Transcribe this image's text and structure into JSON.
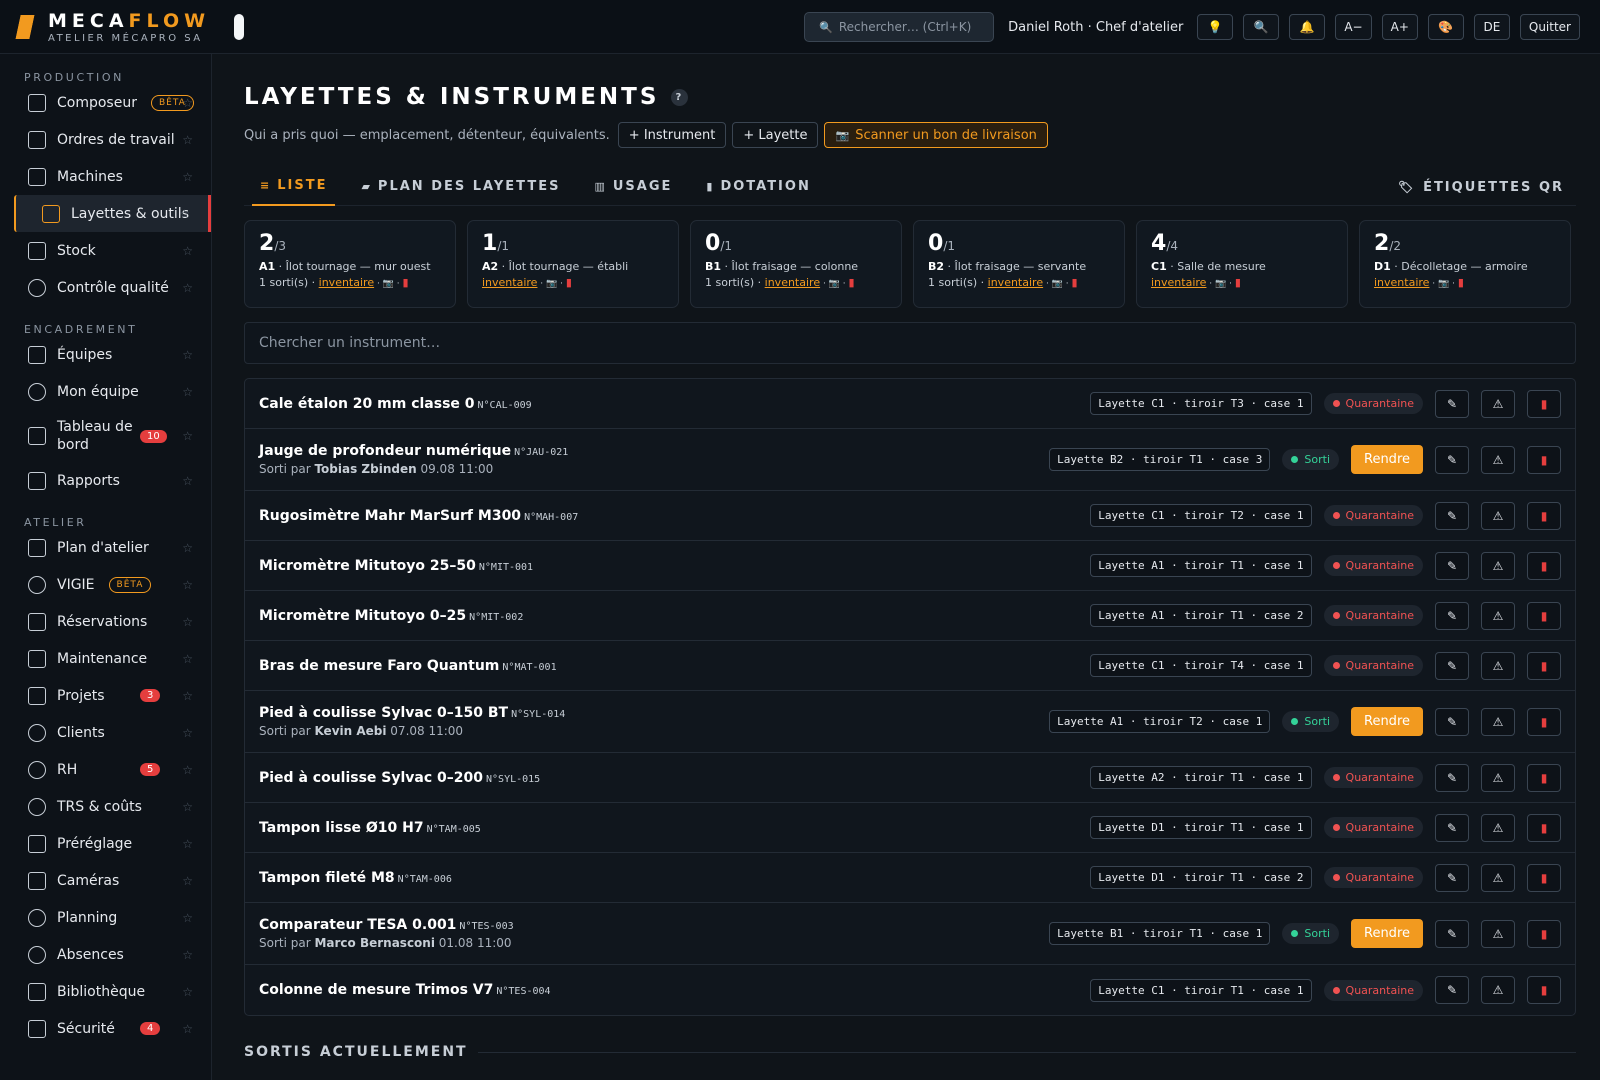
{
  "app": {
    "brand_a": "MECA",
    "brand_b": "FLOW",
    "subtitle": "ATELIER MÉCAPRO SA"
  },
  "topbar": {
    "search_placeholder": "Rechercher…  (Ctrl+K)",
    "user": "Daniel Roth · Chef d'atelier",
    "btn_font_minus": "A−",
    "btn_font_plus": "A+",
    "btn_lang": "DE",
    "btn_quit": "Quitter",
    "icons": [
      "lightbulb-icon",
      "search-icon",
      "bell-icon",
      "palette-icon"
    ]
  },
  "sidebar": {
    "sections": [
      {
        "title": "PRODUCTION",
        "items": [
          {
            "label": "Composeur",
            "beta": "BÊTA",
            "icon": "composer-icon"
          },
          {
            "label": "Ordres de travail",
            "icon": "clipboard-icon"
          },
          {
            "label": "Machines",
            "icon": "grid-icon"
          },
          {
            "label": "Layettes & outils",
            "icon": "box-icon",
            "active": true
          },
          {
            "label": "Stock",
            "icon": "cube-icon"
          },
          {
            "label": "Contrôle qualité",
            "icon": "search-icon"
          }
        ]
      },
      {
        "title": "ENCADREMENT",
        "items": [
          {
            "label": "Équipes",
            "icon": "grid-icon"
          },
          {
            "label": "Mon équipe",
            "icon": "users-icon"
          },
          {
            "label": "Tableau de bord",
            "badge": "10",
            "icon": "bar-chart-icon"
          },
          {
            "label": "Rapports",
            "icon": "trend-icon"
          }
        ]
      },
      {
        "title": "ATELIER",
        "items": [
          {
            "label": "Plan d'atelier",
            "icon": "map-icon"
          },
          {
            "label": "VIGIE",
            "beta": "BÊTA",
            "icon": "target-icon"
          },
          {
            "label": "Réservations",
            "icon": "calendar-icon"
          },
          {
            "label": "Maintenance",
            "icon": "wrench-icon"
          },
          {
            "label": "Projets",
            "badge": "3",
            "icon": "folder-icon"
          },
          {
            "label": "Clients",
            "icon": "users-icon"
          },
          {
            "label": "RH",
            "badge": "5",
            "icon": "user-icon"
          },
          {
            "label": "TRS & coûts",
            "icon": "gauge-icon"
          },
          {
            "label": "Préréglage",
            "icon": "sliders-icon"
          },
          {
            "label": "Caméras",
            "icon": "monitor-icon"
          },
          {
            "label": "Planning",
            "icon": "clock-icon"
          },
          {
            "label": "Absences",
            "icon": "sun-icon"
          },
          {
            "label": "Bibliothèque",
            "icon": "book-icon"
          },
          {
            "label": "Sécurité",
            "badge": "4",
            "icon": "shield-icon"
          }
        ]
      }
    ]
  },
  "page": {
    "title": "LAYETTES & INSTRUMENTS",
    "help": "?",
    "description": "Qui a pris quoi — emplacement, détenteur, équivalents.",
    "btn_instrument": "+ Instrument",
    "btn_layette": "+ Layette",
    "btn_scan": "Scanner un bon de livraison"
  },
  "tabs": [
    {
      "label": "LISTE",
      "icon": "≡",
      "active": true
    },
    {
      "label": "PLAN DES LAYETTES",
      "icon": "▰"
    },
    {
      "label": "USAGE",
      "icon": "▥"
    },
    {
      "label": "DOTATION",
      "icon": "▮"
    }
  ],
  "qr_label": "ÉTIQUETTES QR",
  "kpis": [
    {
      "out": "2",
      "total": "/3",
      "code": "A1",
      "place": " · Îlot tournage — mur ouest",
      "sortis": "1 sorti(s) · ",
      "link": "inventaire"
    },
    {
      "out": "1",
      "total": "/1",
      "code": "A2",
      "place": " · Îlot tournage — établi",
      "sortis": "",
      "link": "inventaire"
    },
    {
      "out": "0",
      "total": "/1",
      "code": "B1",
      "place": " · Îlot fraisage — colonne",
      "sortis": "1 sorti(s) · ",
      "link": "inventaire"
    },
    {
      "out": "0",
      "total": "/1",
      "code": "B2",
      "place": " · Îlot fraisage — servante",
      "sortis": "1 sorti(s) · ",
      "link": "inventaire"
    },
    {
      "out": "4",
      "total": "/4",
      "code": "C1",
      "place": " · Salle de mesure",
      "sortis": "",
      "link": "inventaire"
    },
    {
      "out": "2",
      "total": "/2",
      "code": "D1",
      "place": " · Décolletage — armoire",
      "sortis": "",
      "link": "inventaire"
    }
  ],
  "instrument_search_placeholder": "Chercher un instrument…",
  "status_labels": {
    "quarantine": "Quarantaine",
    "out": "Sorti"
  },
  "return_label": "Rendre",
  "instruments": [
    {
      "name": "Cale étalon 20 mm classe 0",
      "code": "N°CAL-009",
      "location": "Layette C1 · tiroir T3 · case 1",
      "status": "quarantine"
    },
    {
      "name": "Jauge de profondeur numérique",
      "code": "N°JAU-021",
      "location": "Layette B2 · tiroir T1 · case 3",
      "status": "out",
      "by_prefix": "Sorti par ",
      "by": "Tobias Zbinden",
      "when": " 09.08 11:00"
    },
    {
      "name": "Rugosimètre Mahr MarSurf M300",
      "code": "N°MAH-007",
      "location": "Layette C1 · tiroir T2 · case 1",
      "status": "quarantine"
    },
    {
      "name": "Micromètre Mitutoyo 25–50",
      "code": "N°MIT-001",
      "location": "Layette A1 · tiroir T1 · case 1",
      "status": "quarantine"
    },
    {
      "name": "Micromètre Mitutoyo 0–25",
      "code": "N°MIT-002",
      "location": "Layette A1 · tiroir T1 · case 2",
      "status": "quarantine"
    },
    {
      "name": "Bras de mesure Faro Quantum",
      "code": "N°MAT-001",
      "location": "Layette C1 · tiroir T4 · case 1",
      "status": "quarantine"
    },
    {
      "name": "Pied à coulisse Sylvac 0–150 BT",
      "code": "N°SYL-014",
      "location": "Layette A1 · tiroir T2 · case 1",
      "status": "out",
      "by_prefix": "Sorti par ",
      "by": "Kevin Aebi",
      "when": " 07.08 11:00"
    },
    {
      "name": "Pied à coulisse Sylvac 0–200",
      "code": "N°SYL-015",
      "location": "Layette A2 · tiroir T1 · case 1",
      "status": "quarantine"
    },
    {
      "name": "Tampon lisse Ø10 H7",
      "code": "N°TAM-005",
      "location": "Layette D1 · tiroir T1 · case 1",
      "status": "quarantine"
    },
    {
      "name": "Tampon fileté M8",
      "code": "N°TAM-006",
      "location": "Layette D1 · tiroir T1 · case 2",
      "status": "quarantine"
    },
    {
      "name": "Comparateur TESA 0.001",
      "code": "N°TES-003",
      "location": "Layette B1 · tiroir T1 · case 1",
      "status": "out",
      "by_prefix": "Sorti par ",
      "by": "Marco Bernasconi",
      "when": " 01.08 11:00"
    },
    {
      "name": "Colonne de mesure Trimos V7",
      "code": "N°TES-004",
      "location": "Layette C1 · tiroir T1 · case 1",
      "status": "quarantine"
    }
  ],
  "section_current": "SORTIS ACTUELLEMENT",
  "colors": {
    "accent": "#f29a1f",
    "danger": "#e53e3e",
    "success": "#34d399",
    "bg": "#0f1419"
  }
}
